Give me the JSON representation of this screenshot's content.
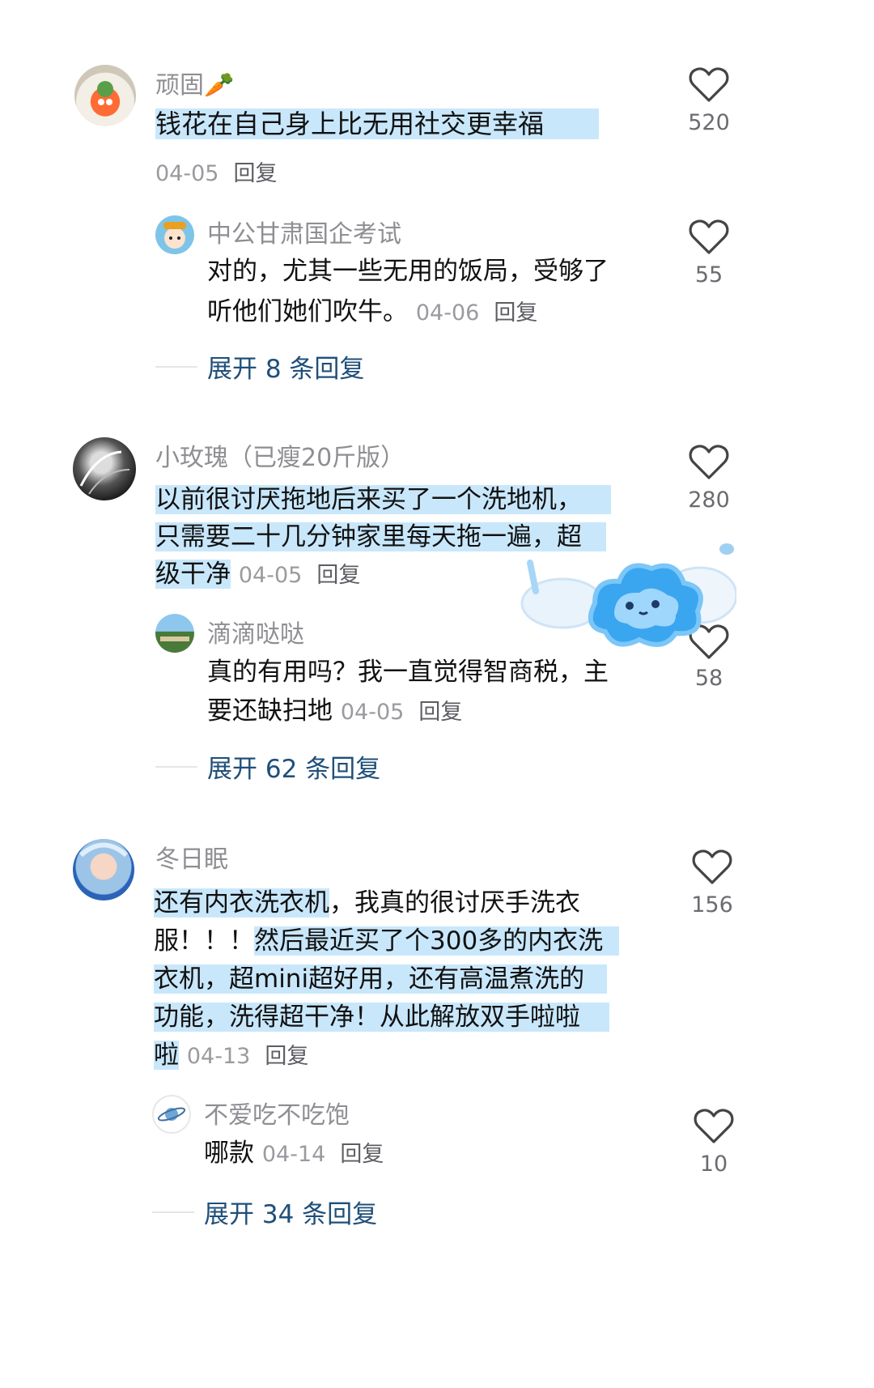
{
  "comments": [
    {
      "author": "顽固🥕",
      "text": "钱花在自己身上比无用社交更幸福",
      "date": "04-05",
      "reply_label": "回复",
      "likes": "520",
      "sub": {
        "author": "中公甘肃国企考试",
        "line1": "对的，尤其一些无用的饭局，受够了",
        "line2": "听他们她们吹牛。",
        "date": "04-06",
        "reply_label": "回复",
        "likes": "55"
      },
      "expand": "展开 8 条回复"
    },
    {
      "author": "小玫瑰（已瘦20斤版）",
      "line1": "以前很讨厌拖地后来买了一个洗地机，",
      "line2": "只需要二十几分钟家里每天拖一遍，超",
      "line3": "级干净",
      "date": "04-05",
      "reply_label": "回复",
      "likes": "280",
      "sub": {
        "author": "滴滴哒哒",
        "line1": "真的有用吗？我一直觉得智商税，主",
        "line2": "要还缺扫地",
        "date": "04-05",
        "reply_label": "回复",
        "likes": "58"
      },
      "expand": "展开 62 条回复"
    },
    {
      "author": "冬日眠",
      "line1a": "还有内衣洗衣机",
      "line1b": "，我真的很讨厌手洗衣",
      "line2a": "服！！！",
      "line2b": "然后最近买了个300多的内衣洗",
      "line3": "衣机，超mini超好用，还有高温煮洗的",
      "line4": "功能，洗得超干净！从此解放双手啦啦",
      "line5": "啦",
      "date": "04-13",
      "reply_label": "回复",
      "likes": "156",
      "sub": {
        "author": "不爱吃不吃饱",
        "line1": "哪款",
        "date": "04-14",
        "reply_label": "回复",
        "likes": "10"
      },
      "expand": "展开 34 条回复"
    }
  ],
  "colors": {
    "highlight": "#c9e7fb",
    "expand": "#1f4f7a",
    "sticker": "#3aa6f0"
  },
  "icons": {
    "like": "heart-outline-icon",
    "sticker": "winged-cloud-sticker"
  }
}
